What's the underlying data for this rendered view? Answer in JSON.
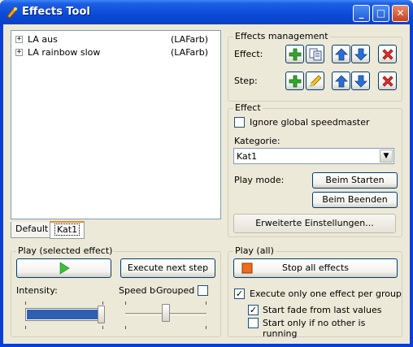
{
  "window": {
    "title": "Effects Tool",
    "minimize": "_",
    "maximize": "□",
    "close": "✕"
  },
  "tree": {
    "items": [
      {
        "label": "LA aus",
        "tag": "(LAFarb)"
      },
      {
        "label": "LA rainbow slow",
        "tag": "(LAFarb)"
      }
    ],
    "expander": "+"
  },
  "tabs": [
    "Default",
    "Kat1"
  ],
  "effects_management": {
    "title": "Effects management",
    "effect_label": "Effect:",
    "step_label": "Step:"
  },
  "effect": {
    "title": "Effect",
    "ignore_speedmaster": "Ignore global speedmaster",
    "kategorie_label": "Kategorie:",
    "kategorie_value": "Kat1",
    "play_mode_label": "Play mode:",
    "beim_starten": "Beim Starten",
    "beim_beenden": "Beim Beenden",
    "erweiterte": "Erweiterte Einstellungen..."
  },
  "play_selected": {
    "title": "Play (selected effect)",
    "execute_next": "Execute next step",
    "intensity_label": "Intensity:",
    "speed_label": "Speed bc",
    "grouped_label": "Grouped",
    "intensity": 1.0,
    "speed": 0.5
  },
  "play_all": {
    "title": "Play (all)",
    "stop_all": "Stop all effects",
    "execute_one": "Execute only one effect per group",
    "execute_one_checked": true,
    "start_fade": "Start fade from last values",
    "start_fade_checked": true,
    "start_only": "Start only if no other is running",
    "start_only_checked": false
  }
}
